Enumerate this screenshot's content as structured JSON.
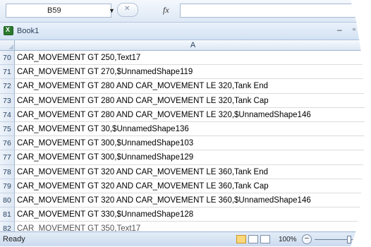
{
  "formula_bar": {
    "name_box": "B59",
    "fx_label": "fx",
    "formula": ""
  },
  "workbook": {
    "title": "Book1"
  },
  "grid": {
    "column": "A",
    "rows": [
      {
        "num": "70",
        "value": "CAR_MOVEMENT GT 250,Text17"
      },
      {
        "num": "71",
        "value": "CAR_MOVEMENT GT 270,$UnnamedShape119"
      },
      {
        "num": "72",
        "value": "CAR_MOVEMENT GT 280 AND CAR_MOVEMENT LE 320,Tank End"
      },
      {
        "num": "73",
        "value": "CAR_MOVEMENT GT 280 AND CAR_MOVEMENT LE 320,Tank Cap"
      },
      {
        "num": "74",
        "value": "CAR_MOVEMENT GT 280 AND CAR_MOVEMENT LE 320,$UnnamedShape146"
      },
      {
        "num": "75",
        "value": "CAR_MOVEMENT GT 30,$UnnamedShape136"
      },
      {
        "num": "76",
        "value": "CAR_MOVEMENT GT 300,$UnnamedShape103"
      },
      {
        "num": "77",
        "value": "CAR_MOVEMENT GT 300,$UnnamedShape129"
      },
      {
        "num": "78",
        "value": "CAR_MOVEMENT GT 320 AND CAR_MOVEMENT LE 360,Tank End"
      },
      {
        "num": "79",
        "value": "CAR_MOVEMENT GT 320 AND CAR_MOVEMENT LE 360,Tank Cap"
      },
      {
        "num": "80",
        "value": "CAR_MOVEMENT GT 320 AND CAR_MOVEMENT LE 360,$UnnamedShape146"
      },
      {
        "num": "81",
        "value": "CAR_MOVEMENT GT 330,$UnnamedShape128"
      },
      {
        "num": "82",
        "value": "CAR_MOVEMENT GT 350,Text17"
      }
    ]
  },
  "status_bar": {
    "status": "Ready",
    "zoom": "100%",
    "zoom_out": "−"
  },
  "icons": {
    "name_dropdown": "chevron-down-icon",
    "workbook": "excel-file-icon",
    "minimize": "minimize-icon"
  },
  "colors": {
    "header_bg": "#dbe6f3",
    "grid_line": "#dadcdd",
    "active_view": "#fbd87a"
  }
}
